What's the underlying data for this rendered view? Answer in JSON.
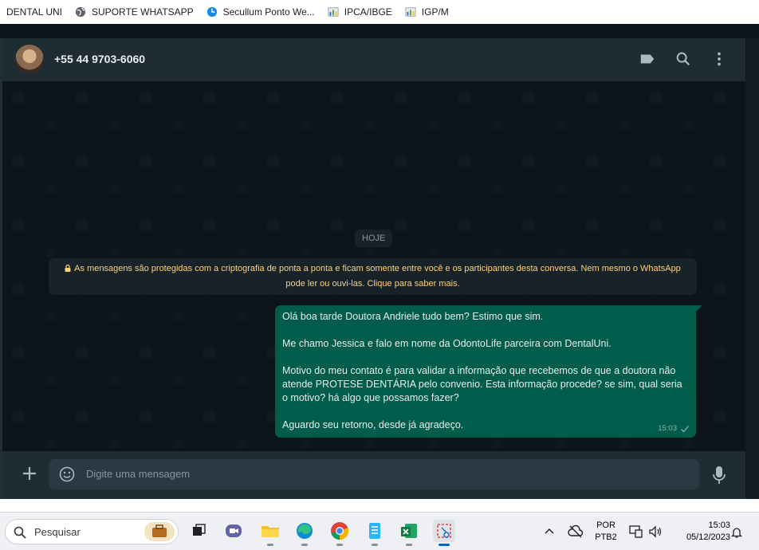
{
  "bookmarks": [
    {
      "label": "DENTAL UNI",
      "icon": "none"
    },
    {
      "label": "SUPORTE WHATSAPP",
      "icon": "globe-icon"
    },
    {
      "label": "Secullum Ponto We...",
      "icon": "secullum-icon"
    },
    {
      "label": "IPCA/IBGE",
      "icon": "ibge-icon"
    },
    {
      "label": "IGP/M",
      "icon": "ibge-icon"
    }
  ],
  "chat": {
    "contact_name": "+55 44 9703-6060",
    "date_divider": "HOJE",
    "encryption_notice": "As mensagens são protegidas com a criptografia de ponta a ponta e ficam somente entre você e os participantes desta conversa. Nem mesmo o WhatsApp pode ler ou ouvi-las. Clique para saber mais.",
    "message": {
      "paragraphs": [
        "Olá boa tarde Doutora Andriele tudo bem? Estimo que sim.",
        "Me chamo Jessica e falo em nome da OdontoLife parceira com DentalUni.",
        "Motivo do meu contato é para validar a informação que recebemos de que a doutora não atende PROTESE DENTÁRIA pelo convenio. Esta informação procede? se sim, qual seria o motivo? há algo que possamos fazer?",
        "Aguardo seu retorno, desde já agradeço."
      ],
      "time": "15:03",
      "status": "sent"
    },
    "input_placeholder": "Digite uma mensagem"
  },
  "taskbar": {
    "search_label": "Pesquisar",
    "language_line1": "POR",
    "language_line2": "PTB2",
    "time": "15:03",
    "date": "05/12/2023"
  },
  "colors": {
    "header_bg": "#202c33",
    "chat_bg": "#0b141a",
    "outgoing_bubble": "#005c4b",
    "notice_text": "#ffd279"
  }
}
